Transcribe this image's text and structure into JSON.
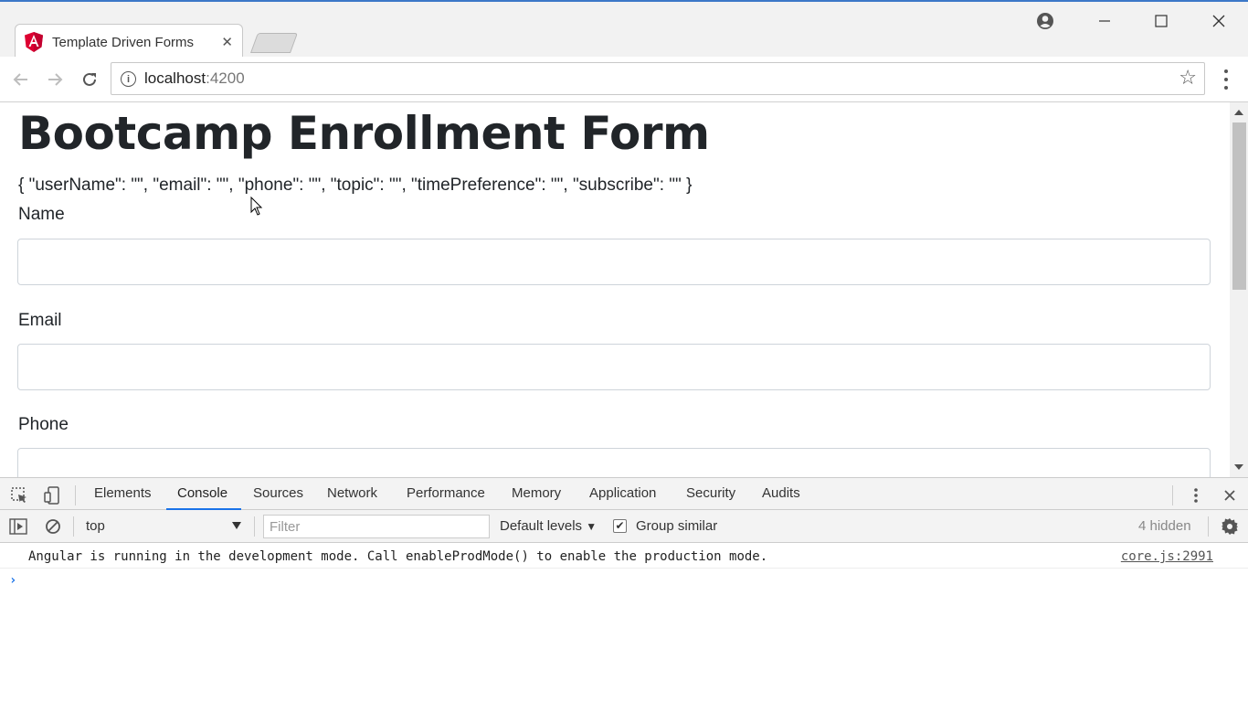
{
  "browser": {
    "tab_title": "Template Driven Forms",
    "tab_close": "✕",
    "url_host": "localhost",
    "url_port": ":4200",
    "icons": [
      "angular-icon",
      "user-icon",
      "minimize-icon",
      "maximize-icon",
      "close-icon",
      "back-icon",
      "forward-icon",
      "reload-icon",
      "info-icon",
      "star-icon",
      "menu-icon"
    ]
  },
  "page": {
    "title": "Bootcamp Enrollment Form",
    "model_json": "{ \"userName\": \"\", \"email\": \"\", \"phone\": \"\", \"topic\": \"\", \"timePreference\": \"\", \"subscribe\": \"\" }",
    "fields": [
      {
        "label": "Name",
        "value": ""
      },
      {
        "label": "Email",
        "value": ""
      },
      {
        "label": "Phone",
        "value": ""
      }
    ]
  },
  "devtools": {
    "tabs": [
      "Elements",
      "Console",
      "Sources",
      "Network",
      "Performance",
      "Memory",
      "Application",
      "Security",
      "Audits"
    ],
    "active_tab": "Console",
    "context": "top",
    "filter_placeholder": "Filter",
    "levels": "Default levels",
    "group_similar": "Group similar",
    "hidden": "4 hidden",
    "messages": [
      {
        "text": "Angular is running in the development mode. Call enableProdMode() to enable the production mode.",
        "source": "core.js:2991"
      }
    ],
    "prompt": "›",
    "accent_color": "#1a73e8"
  }
}
